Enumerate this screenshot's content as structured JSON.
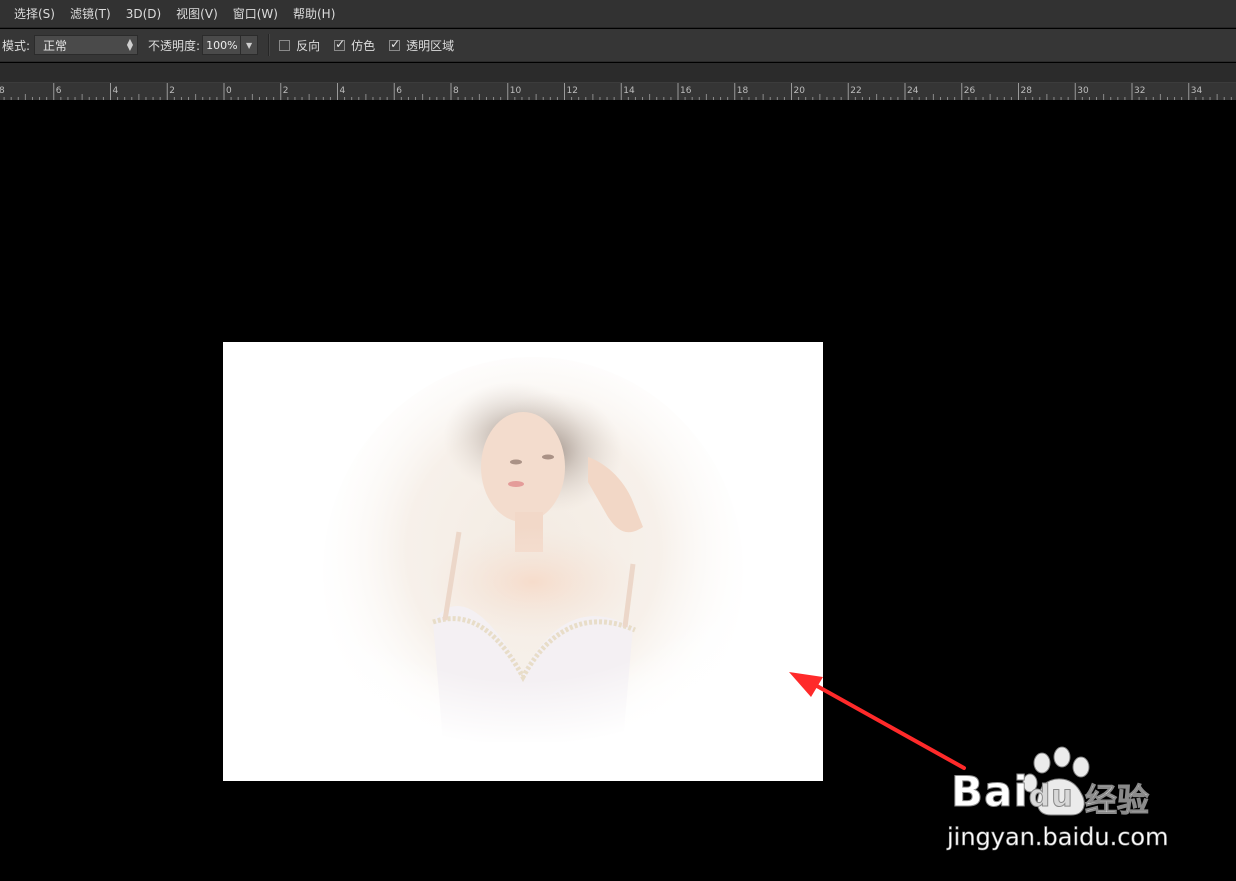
{
  "menu": [
    "选择(S)",
    "滤镜(T)",
    "3D(D)",
    "视图(V)",
    "窗口(W)",
    "帮助(H)"
  ],
  "options": {
    "mode_label": "模式:",
    "mode_value": "正常",
    "opacity_label": "不透明度:",
    "opacity_value": "100%",
    "reverse_label": "反向",
    "reverse_checked": false,
    "dither_label": "仿色",
    "dither_checked": true,
    "transparency_label": "透明区域",
    "transparency_checked": true
  },
  "ruler": {
    "labels": [
      "8",
      "6",
      "4",
      "2",
      "0",
      "2",
      "4",
      "6",
      "8",
      "10",
      "12",
      "14",
      "16",
      "18",
      "20",
      "22",
      "24",
      "26",
      "28",
      "30",
      "32",
      "34"
    ]
  },
  "watermark": {
    "brand": "Bai",
    "brand_suffix": "du",
    "product": "经验",
    "url": "jingyan.baidu.com"
  },
  "colors": {
    "menubar_bg": "#323232",
    "optionsbar_bg": "#363636",
    "canvas_bg": "#000000",
    "arrow": "#ff2a2a"
  }
}
